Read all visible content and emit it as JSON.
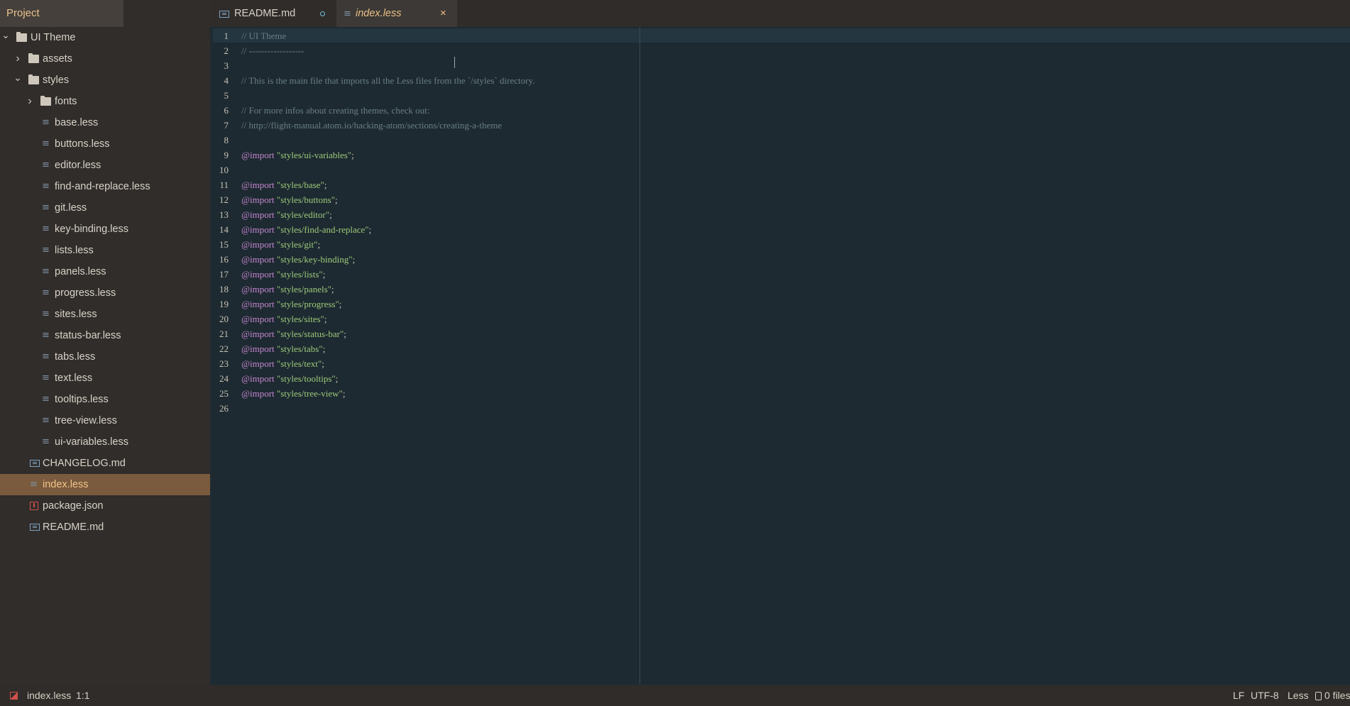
{
  "sidebar": {
    "title": "Project",
    "tree": [
      {
        "label": "UI Theme",
        "type": "folder",
        "depth": 0,
        "chevron": "down"
      },
      {
        "label": "assets",
        "type": "folder",
        "depth": 1,
        "chevron": "right"
      },
      {
        "label": "styles",
        "type": "folder",
        "depth": 1,
        "chevron": "down"
      },
      {
        "label": "fonts",
        "type": "folder",
        "depth": 2,
        "chevron": "right"
      },
      {
        "label": "base.less",
        "type": "less",
        "depth": 2
      },
      {
        "label": "buttons.less",
        "type": "less",
        "depth": 2
      },
      {
        "label": "editor.less",
        "type": "less",
        "depth": 2
      },
      {
        "label": "find-and-replace.less",
        "type": "less",
        "depth": 2
      },
      {
        "label": "git.less",
        "type": "less",
        "depth": 2
      },
      {
        "label": "key-binding.less",
        "type": "less",
        "depth": 2
      },
      {
        "label": "lists.less",
        "type": "less",
        "depth": 2
      },
      {
        "label": "panels.less",
        "type": "less",
        "depth": 2
      },
      {
        "label": "progress.less",
        "type": "less",
        "depth": 2
      },
      {
        "label": "sites.less",
        "type": "less",
        "depth": 2
      },
      {
        "label": "status-bar.less",
        "type": "less",
        "depth": 2
      },
      {
        "label": "tabs.less",
        "type": "less",
        "depth": 2
      },
      {
        "label": "text.less",
        "type": "less",
        "depth": 2
      },
      {
        "label": "tooltips.less",
        "type": "less",
        "depth": 2
      },
      {
        "label": "tree-view.less",
        "type": "less",
        "depth": 2
      },
      {
        "label": "ui-variables.less",
        "type": "less",
        "depth": 2
      },
      {
        "label": "CHANGELOG.md",
        "type": "md",
        "depth": 1
      },
      {
        "label": "index.less",
        "type": "less",
        "depth": 1,
        "selected": true
      },
      {
        "label": "package.json",
        "type": "pkg",
        "depth": 1
      },
      {
        "label": "README.md",
        "type": "md",
        "depth": 1
      }
    ]
  },
  "tabs": [
    {
      "label": "README.md",
      "icon": "markdown-icon",
      "indicator": "modified"
    },
    {
      "label": "index.less",
      "icon": "less-file-icon",
      "indicator": "close",
      "close_glyph": "×",
      "active": true
    }
  ],
  "editor": {
    "lines": [
      [
        {
          "t": "// UI Theme",
          "c": "comment"
        }
      ],
      [
        {
          "t": "// ------------------",
          "c": "comment"
        }
      ],
      [],
      [
        {
          "t": "// This is the main file that imports all the Less files from the `/styles` directory.",
          "c": "comment"
        }
      ],
      [],
      [
        {
          "t": "// For more infos about creating themes, check out:",
          "c": "comment"
        }
      ],
      [
        {
          "t": "// http://flight-manual.atom.io/hacking-atom/sections/creating-a-theme",
          "c": "comment"
        }
      ],
      [],
      [
        {
          "t": "@import",
          "c": "kw"
        },
        {
          "t": " ",
          "c": "punc"
        },
        {
          "t": "\"styles/ui-variables\"",
          "c": "str"
        },
        {
          "t": ";",
          "c": "punc"
        }
      ],
      [],
      [
        {
          "t": "@import",
          "c": "kw"
        },
        {
          "t": " ",
          "c": "punc"
        },
        {
          "t": "\"styles/base\"",
          "c": "str"
        },
        {
          "t": ";",
          "c": "punc"
        }
      ],
      [
        {
          "t": "@import",
          "c": "kw"
        },
        {
          "t": " ",
          "c": "punc"
        },
        {
          "t": "\"styles/buttons\"",
          "c": "str"
        },
        {
          "t": ";",
          "c": "punc"
        }
      ],
      [
        {
          "t": "@import",
          "c": "kw"
        },
        {
          "t": " ",
          "c": "punc"
        },
        {
          "t": "\"styles/editor\"",
          "c": "str"
        },
        {
          "t": ";",
          "c": "punc"
        }
      ],
      [
        {
          "t": "@import",
          "c": "kw"
        },
        {
          "t": " ",
          "c": "punc"
        },
        {
          "t": "\"styles/find-and-replace\"",
          "c": "str"
        },
        {
          "t": ";",
          "c": "punc"
        }
      ],
      [
        {
          "t": "@import",
          "c": "kw"
        },
        {
          "t": " ",
          "c": "punc"
        },
        {
          "t": "\"styles/git\"",
          "c": "str"
        },
        {
          "t": ";",
          "c": "punc"
        }
      ],
      [
        {
          "t": "@import",
          "c": "kw"
        },
        {
          "t": " ",
          "c": "punc"
        },
        {
          "t": "\"styles/key-binding\"",
          "c": "str"
        },
        {
          "t": ";",
          "c": "punc"
        }
      ],
      [
        {
          "t": "@import",
          "c": "kw"
        },
        {
          "t": " ",
          "c": "punc"
        },
        {
          "t": "\"styles/lists\"",
          "c": "str"
        },
        {
          "t": ";",
          "c": "punc"
        }
      ],
      [
        {
          "t": "@import",
          "c": "kw"
        },
        {
          "t": " ",
          "c": "punc"
        },
        {
          "t": "\"styles/panels\"",
          "c": "str"
        },
        {
          "t": ";",
          "c": "punc"
        }
      ],
      [
        {
          "t": "@import",
          "c": "kw"
        },
        {
          "t": " ",
          "c": "punc"
        },
        {
          "t": "\"styles/progress\"",
          "c": "str"
        },
        {
          "t": ";",
          "c": "punc"
        }
      ],
      [
        {
          "t": "@import",
          "c": "kw"
        },
        {
          "t": " ",
          "c": "punc"
        },
        {
          "t": "\"styles/sites\"",
          "c": "str"
        },
        {
          "t": ";",
          "c": "punc"
        }
      ],
      [
        {
          "t": "@import",
          "c": "kw"
        },
        {
          "t": " ",
          "c": "punc"
        },
        {
          "t": "\"styles/status-bar\"",
          "c": "str"
        },
        {
          "t": ";",
          "c": "punc"
        }
      ],
      [
        {
          "t": "@import",
          "c": "kw"
        },
        {
          "t": " ",
          "c": "punc"
        },
        {
          "t": "\"styles/tabs\"",
          "c": "str"
        },
        {
          "t": ";",
          "c": "punc"
        }
      ],
      [
        {
          "t": "@import",
          "c": "kw"
        },
        {
          "t": " ",
          "c": "punc"
        },
        {
          "t": "\"styles/text\"",
          "c": "str"
        },
        {
          "t": ";",
          "c": "punc"
        }
      ],
      [
        {
          "t": "@import",
          "c": "kw"
        },
        {
          "t": " ",
          "c": "punc"
        },
        {
          "t": "\"styles/tooltips\"",
          "c": "str"
        },
        {
          "t": ";",
          "c": "punc"
        }
      ],
      [
        {
          "t": "@import",
          "c": "kw"
        },
        {
          "t": " ",
          "c": "punc"
        },
        {
          "t": "\"styles/tree-view\"",
          "c": "str"
        },
        {
          "t": ";",
          "c": "punc"
        }
      ],
      []
    ]
  },
  "statusbar": {
    "file_name": "index.less",
    "cursor_position": "1:1",
    "line_ending": "LF",
    "encoding": "UTF-8",
    "grammar": "Less",
    "selection_count": "0 files"
  },
  "colors": {
    "sidebar_bg": "#302d2b",
    "selected_bg": "#7a5b3e",
    "accent": "#e9bf86",
    "editor_bg": "#1d2a31",
    "comment": "#6b7e88",
    "keyword": "#c586d0",
    "string": "#9ec97a"
  }
}
